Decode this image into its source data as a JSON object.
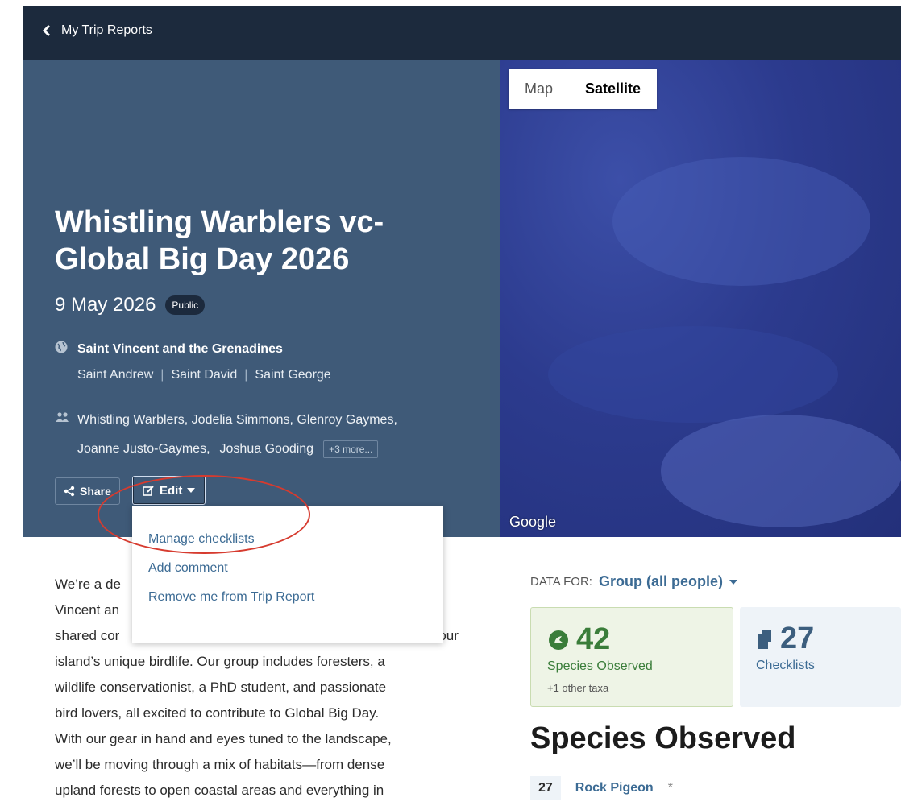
{
  "nav": {
    "back_label": "My Trip Reports"
  },
  "trip": {
    "title": "Whistling Warblers vc-Global Big Day 2026",
    "date": "9 May 2026",
    "visibility": "Public",
    "country": "Saint Vincent and the Grenadines",
    "regions": [
      "Saint Andrew",
      "Saint David",
      "Saint George"
    ],
    "participants": [
      "Whistling Warblers,",
      "Jodelia Simmons,",
      "Glenroy Gaymes,",
      "Joanne Justo-Gaymes,",
      "Joshua Gooding"
    ],
    "more_label": "+3 more..."
  },
  "actions": {
    "share_label": "Share",
    "edit_label": "Edit"
  },
  "edit_menu": {
    "items": [
      "Manage checklists",
      "Add comment",
      "Remove me from Trip Report"
    ]
  },
  "map": {
    "tab_map": "Map",
    "tab_satellite": "Satellite",
    "active_tab": "Satellite",
    "attribution": "Google"
  },
  "description": "We’re a de Vincent an shared cor our island’s unique birdlife. Our group includes foresters, a wildlife conservationist, a PhD student, and passionate bird lovers, all excited to contribute to Global Big Day. With our gear in hand and eyes tuned to the landscape, we’ll be moving through a mix of habitats—from dense upland forests to open coastal areas and everything in",
  "description_lines": [
    "We’re a de",
    "Vincent an",
    "shared cor",
    "island’s unique birdlife. Our group includes foresters, a",
    "wildlife conservationist, a PhD student, and passionate",
    "bird lovers, all excited to contribute to Global Big Day.",
    "With our gear in hand and eyes tuned to the landscape,",
    "we’ll be moving through a mix of habitats—from dense",
    "upland forests to open coastal areas and everything in"
  ],
  "description_line3_tail": "our",
  "data_for": {
    "label": "DATA FOR:",
    "value": "Group (all people)"
  },
  "stats": {
    "species": {
      "value": "42",
      "label": "Species Observed",
      "sub": "+1 other taxa"
    },
    "checklists": {
      "value": "27",
      "label": "Checklists"
    }
  },
  "species_section": {
    "title": "Species Observed"
  },
  "species_list": [
    {
      "count": "27",
      "name": "Rock Pigeon",
      "marker": "*"
    }
  ],
  "colors": {
    "hero_bg": "#3f5a78",
    "topbar_bg": "#1c2a3d",
    "link": "#3c6b94",
    "species_green": "#3a7d3a",
    "highlight_red": "#d63b2f"
  }
}
